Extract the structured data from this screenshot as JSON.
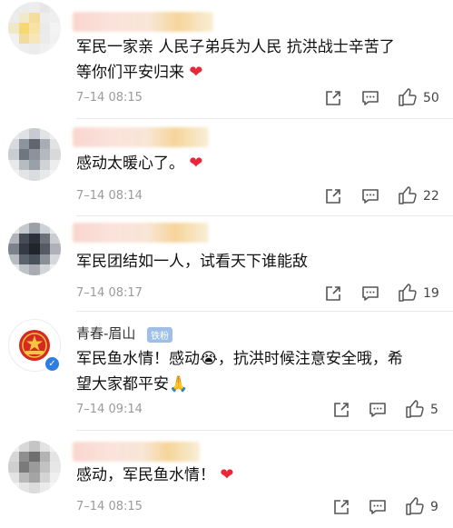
{
  "comments": [
    {
      "text": "军民一家亲 人民子弟兵为人民 抗洪战士辛苦了",
      "text2": "等你们平安归来",
      "heart": "❤",
      "time": "7–14 08:15",
      "likes": "50"
    },
    {
      "text": "感动太暖心了。",
      "heart": "❤",
      "time": "7–14 08:14",
      "likes": "22"
    },
    {
      "text": "军民团结如一人，试看天下谁能敌",
      "time": "7–14 08:17",
      "likes": "19"
    },
    {
      "username": "青春-眉山",
      "tag": "铁粉",
      "verified": "✓",
      "text": "军民鱼水情！感动",
      "emoji_cry": "😭",
      "text_cont": "，抗洪时候注意安全哦，希",
      "text2": "望大家都平安",
      "emoji_pray": "🙏",
      "time": "7–14 09:14",
      "likes": "5"
    },
    {
      "text": "感动，军民鱼水情！",
      "heart": "❤",
      "time": "7–14 08:15",
      "likes": "9"
    }
  ],
  "colors": {
    "heart": "#e8283a",
    "verified": "#2f7de1",
    "muted": "#9a9a9a"
  },
  "icons": [
    "share-icon",
    "comment-icon",
    "thumbs-up-icon"
  ]
}
